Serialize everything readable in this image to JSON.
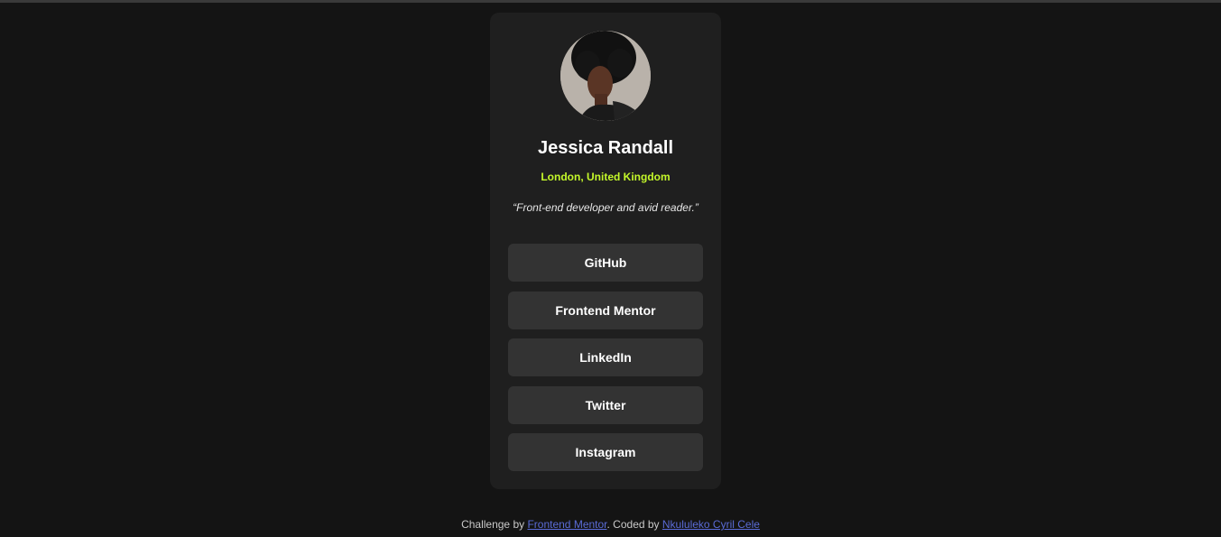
{
  "profile": {
    "avatar_alt": "Jessica Randall",
    "name": "Jessica Randall",
    "location": "London, United Kingdom",
    "bio": "“Front-end developer and avid reader.”"
  },
  "links": [
    {
      "label": "GitHub"
    },
    {
      "label": "Frontend Mentor"
    },
    {
      "label": "LinkedIn"
    },
    {
      "label": "Twitter"
    },
    {
      "label": "Instagram"
    }
  ],
  "footer": {
    "prefix": "Challenge by ",
    "challenge_link": "Frontend Mentor",
    "middle": ". Coded by ",
    "author_link": "Nkululeko Cyril Cele"
  },
  "colors": {
    "background": "#141414",
    "card": "#1f1f1f",
    "button": "#333333",
    "accent": "#c4f82a",
    "link": "#5a6bd6"
  }
}
